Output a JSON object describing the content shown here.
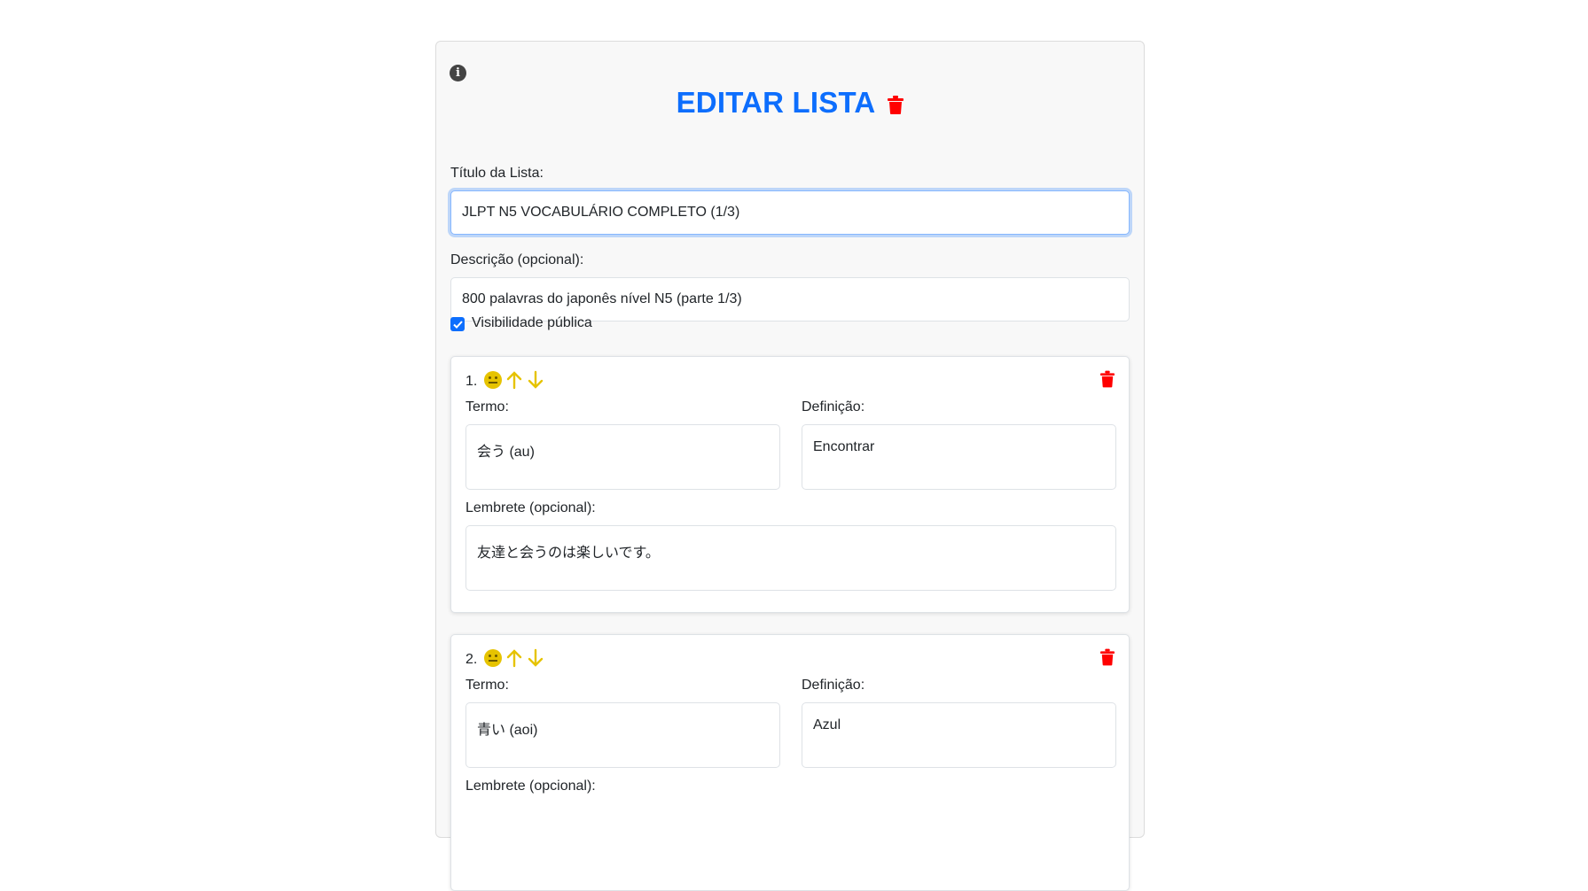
{
  "header": {
    "title": "EDITAR LISTA"
  },
  "form": {
    "title_label": "Título da Lista:",
    "title_value": "JLPT N5 VOCABULÁRIO COMPLETO (1/3)",
    "description_label": "Descrição (opcional):",
    "description_value": "800 palavras do japonês nível N5 (parte 1/3)",
    "visibility_label": "Visibilidade pública",
    "visibility_checked": true
  },
  "cards": [
    {
      "number": "1.",
      "term_label": "Termo:",
      "term_value": "会う (au)",
      "definition_label": "Definição:",
      "definition_value": "Encontrar",
      "reminder_label": "Lembrete (opcional):",
      "reminder_value": "友達と会うのは楽しいです。"
    },
    {
      "number": "2.",
      "term_label": "Termo:",
      "term_value": "青い (aoi)",
      "definition_label": "Definição:",
      "definition_value": "Azul",
      "reminder_label": "Lembrete (opcional):",
      "reminder_value": ""
    }
  ],
  "colors": {
    "accent": "#0d6efd",
    "delete": "#ff0000",
    "status_icon": "#e6c300"
  },
  "icons": {
    "info": "info-circle-icon",
    "delete": "trash-icon",
    "status": "neutral-face-icon",
    "move_up": "arrow-up-icon",
    "move_down": "arrow-down-icon",
    "checkbox": "check-icon"
  }
}
